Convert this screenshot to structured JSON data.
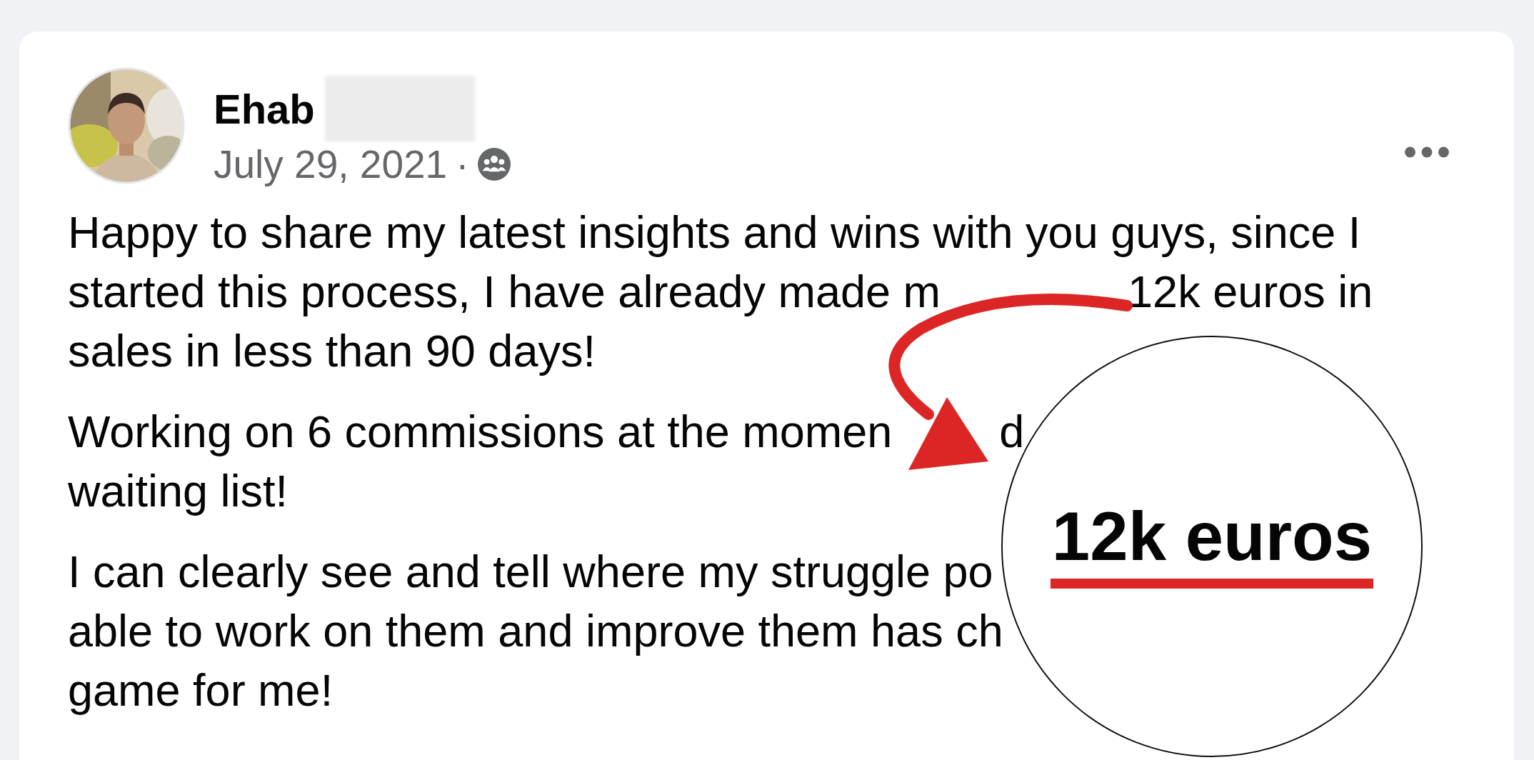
{
  "post": {
    "author": "Ehab",
    "date": "July 29, 2021",
    "separator": "·",
    "paragraphs": [
      [
        "Happy to share my latest insights and wins with you guys, since I",
        [
          "started this process, I have already made m",
          "12k euros in"
        ],
        "sales in less than 90 days!"
      ],
      [
        [
          "Working on 6 commissions at the momen",
          "d"
        ],
        "waiting list!"
      ],
      [
        "I can clearly see and tell where my struggle po",
        "able to work on them and improve them has ch",
        "game for me!"
      ]
    ]
  },
  "annotation": {
    "highlight": "12k euros"
  }
}
